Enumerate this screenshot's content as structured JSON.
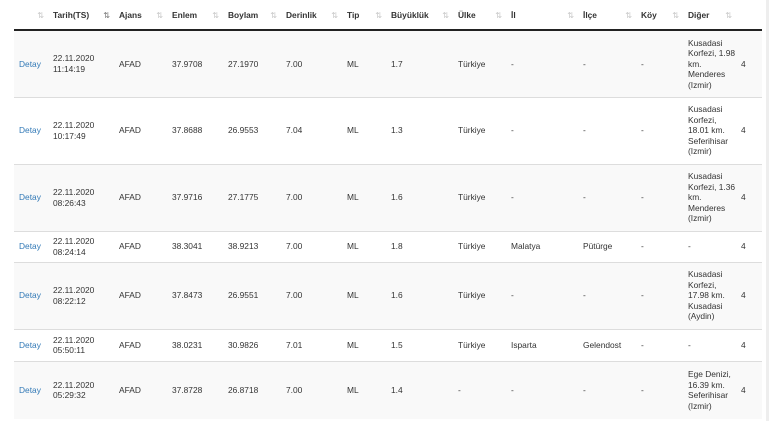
{
  "columns": {
    "detail": "",
    "date": "Tarih(TS)",
    "agency": "Ajans",
    "lat": "Enlem",
    "lon": "Boylam",
    "depth": "Derinlik",
    "type": "Tip",
    "magnitude": "Büyüklük",
    "country": "Ülke",
    "province": "İl",
    "district": "İlçe",
    "village": "Köy",
    "other": "Diğer"
  },
  "sort_icon": "⇅",
  "sort_active_icon": "⇅",
  "rows": [
    {
      "detail": "Detay",
      "date": "22.11.2020",
      "time": "11:14:19",
      "agency": "AFAD",
      "lat": "37.9708",
      "lon": "27.1970",
      "depth": "7.00",
      "type": "ML",
      "magnitude": "1.7",
      "country": "Türkiye",
      "province": "-",
      "district": "-",
      "village": "-",
      "other": "Kusadasi Korfezi, 1.98 km. Menderes (Izmir)",
      "extra": "4"
    },
    {
      "detail": "Detay",
      "date": "22.11.2020",
      "time": "10:17:49",
      "agency": "AFAD",
      "lat": "37.8688",
      "lon": "26.9553",
      "depth": "7.04",
      "type": "ML",
      "magnitude": "1.3",
      "country": "Türkiye",
      "province": "-",
      "district": "-",
      "village": "-",
      "other": "Kusadasi Korfezi, 18.01 km. Seferihisar (Izmir)",
      "extra": "4"
    },
    {
      "detail": "Detay",
      "date": "22.11.2020",
      "time": "08:26:43",
      "agency": "AFAD",
      "lat": "37.9716",
      "lon": "27.1775",
      "depth": "7.00",
      "type": "ML",
      "magnitude": "1.6",
      "country": "Türkiye",
      "province": "-",
      "district": "-",
      "village": "-",
      "other": "Kusadasi Korfezi, 1.36 km. Menderes (Izmir)",
      "extra": "4"
    },
    {
      "detail": "Detay",
      "date": "22.11.2020",
      "time": "08:24:14",
      "agency": "AFAD",
      "lat": "38.3041",
      "lon": "38.9213",
      "depth": "7.00",
      "type": "ML",
      "magnitude": "1.8",
      "country": "Türkiye",
      "province": "Malatya",
      "district": "Pütürge",
      "village": "-",
      "other": "-",
      "extra": "4"
    },
    {
      "detail": "Detay",
      "date": "22.11.2020",
      "time": "08:22:12",
      "agency": "AFAD",
      "lat": "37.8473",
      "lon": "26.9551",
      "depth": "7.00",
      "type": "ML",
      "magnitude": "1.6",
      "country": "Türkiye",
      "province": "-",
      "district": "-",
      "village": "-",
      "other": "Kusadasi Korfezi, 17.98 km. Kusadasi (Aydin)",
      "extra": "4"
    },
    {
      "detail": "Detay",
      "date": "22.11.2020",
      "time": "05:50:11",
      "agency": "AFAD",
      "lat": "38.0231",
      "lon": "30.9826",
      "depth": "7.01",
      "type": "ML",
      "magnitude": "1.5",
      "country": "Türkiye",
      "province": "Isparta",
      "district": "Gelendost",
      "village": "-",
      "other": "-",
      "extra": "4"
    },
    {
      "detail": "Detay",
      "date": "22.11.2020",
      "time": "05:29:32",
      "agency": "AFAD",
      "lat": "37.8728",
      "lon": "26.8718",
      "depth": "7.00",
      "type": "ML",
      "magnitude": "1.4",
      "country": "-",
      "province": "-",
      "district": "-",
      "village": "-",
      "other": "Ege Denizi, 16.39 km. Seferihisar (Izmir)",
      "extra": "4"
    }
  ]
}
